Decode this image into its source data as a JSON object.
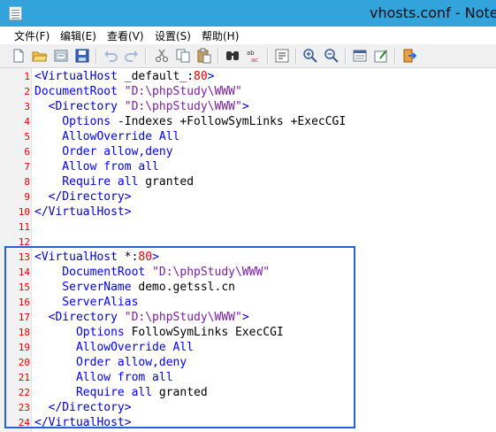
{
  "window": {
    "title": "vhosts.conf - Notepad"
  },
  "menu": [
    {
      "label": "文件(F)"
    },
    {
      "label": "编辑(E)"
    },
    {
      "label": "查看(V)"
    },
    {
      "label": "设置(S)"
    },
    {
      "label": "帮助(H)"
    }
  ],
  "toolbar": [
    {
      "icon": "new-file-icon"
    },
    {
      "icon": "open-folder-icon"
    },
    {
      "icon": "reload-icon"
    },
    {
      "icon": "save-icon"
    },
    {
      "icon": "undo-icon"
    },
    {
      "icon": "redo-icon"
    },
    {
      "icon": "cut-icon"
    },
    {
      "icon": "copy-icon"
    },
    {
      "icon": "paste-icon"
    },
    {
      "icon": "find-icon"
    },
    {
      "icon": "replace-icon"
    },
    {
      "icon": "goto-icon"
    },
    {
      "icon": "zoom-in-icon"
    },
    {
      "icon": "zoom-out-icon"
    },
    {
      "icon": "view-icon"
    },
    {
      "icon": "settings-icon"
    },
    {
      "icon": "exit-icon"
    }
  ],
  "colors": {
    "tag": "#0000c8",
    "attribute": "#7a1fa2",
    "keyword": "#0000ff",
    "line_number": "#e00000",
    "highlight_border": "#2a5fd8",
    "titlebar": "#33a3dc"
  },
  "lines": [
    {
      "num": "1",
      "segments": [
        {
          "t": "<VirtualHost",
          "c": "tag"
        },
        {
          "t": " _default_:",
          "c": "plain"
        },
        {
          "t": "80",
          "c": "num"
        },
        {
          "t": ">",
          "c": "tag"
        }
      ]
    },
    {
      "num": "2",
      "segments": [
        {
          "t": "DocumentRoot",
          "c": "kw"
        },
        {
          "t": " ",
          "c": "plain"
        },
        {
          "t": "\"D:\\phpStudy\\WWW\"",
          "c": "str"
        }
      ]
    },
    {
      "num": "3",
      "segments": [
        {
          "t": "  <Directory",
          "c": "tag"
        },
        {
          "t": " ",
          "c": "plain"
        },
        {
          "t": "\"D:\\phpStudy\\WWW\"",
          "c": "str"
        },
        {
          "t": ">",
          "c": "tag"
        }
      ]
    },
    {
      "num": "4",
      "segments": [
        {
          "t": "    Options",
          "c": "kw"
        },
        {
          "t": " -Indexes +FollowSymLinks +ExecCGI",
          "c": "plain"
        }
      ]
    },
    {
      "num": "5",
      "segments": [
        {
          "t": "    AllowOverride All",
          "c": "kw"
        }
      ]
    },
    {
      "num": "6",
      "segments": [
        {
          "t": "    Order allow,deny",
          "c": "kw"
        }
      ]
    },
    {
      "num": "7",
      "segments": [
        {
          "t": "    Allow from all",
          "c": "kw"
        }
      ]
    },
    {
      "num": "8",
      "segments": [
        {
          "t": "    Require all",
          "c": "kw"
        },
        {
          "t": " granted",
          "c": "plain"
        }
      ]
    },
    {
      "num": "9",
      "segments": [
        {
          "t": "  </Directory>",
          "c": "tag"
        }
      ]
    },
    {
      "num": "10",
      "segments": [
        {
          "t": "</VirtualHost>",
          "c": "tag"
        }
      ]
    },
    {
      "num": "11",
      "segments": []
    },
    {
      "num": "12",
      "segments": []
    },
    {
      "num": "13",
      "segments": [
        {
          "t": "<VirtualHost",
          "c": "tag"
        },
        {
          "t": " *:",
          "c": "plain"
        },
        {
          "t": "80",
          "c": "num"
        },
        {
          "t": ">",
          "c": "tag"
        }
      ]
    },
    {
      "num": "14",
      "segments": [
        {
          "t": "    DocumentRoot",
          "c": "kw"
        },
        {
          "t": " ",
          "c": "plain"
        },
        {
          "t": "\"D:\\phpStudy\\WWW\"",
          "c": "str"
        }
      ]
    },
    {
      "num": "15",
      "segments": [
        {
          "t": "    ServerName",
          "c": "kw"
        },
        {
          "t": " demo.getssl.cn",
          "c": "plain"
        }
      ]
    },
    {
      "num": "16",
      "segments": [
        {
          "t": "    ServerAlias",
          "c": "kw"
        }
      ]
    },
    {
      "num": "17",
      "segments": [
        {
          "t": "  <Directory",
          "c": "tag"
        },
        {
          "t": " ",
          "c": "plain"
        },
        {
          "t": "\"D:\\phpStudy\\WWW\"",
          "c": "str"
        },
        {
          "t": ">",
          "c": "tag"
        }
      ]
    },
    {
      "num": "18",
      "segments": [
        {
          "t": "      Options",
          "c": "kw"
        },
        {
          "t": " FollowSymLinks ExecCGI",
          "c": "plain"
        }
      ]
    },
    {
      "num": "19",
      "segments": [
        {
          "t": "      AllowOverride All",
          "c": "kw"
        }
      ]
    },
    {
      "num": "20",
      "segments": [
        {
          "t": "      Order allow,deny",
          "c": "kw"
        }
      ]
    },
    {
      "num": "21",
      "segments": [
        {
          "t": "      Allow from all",
          "c": "kw"
        }
      ]
    },
    {
      "num": "22",
      "segments": [
        {
          "t": "      Require all",
          "c": "kw"
        },
        {
          "t": " granted",
          "c": "plain"
        }
      ]
    },
    {
      "num": "23",
      "segments": [
        {
          "t": "  </Directory>",
          "c": "tag"
        }
      ]
    },
    {
      "num": "24",
      "segments": [
        {
          "t": "</VirtualHost>",
          "c": "tag"
        }
      ]
    }
  ]
}
